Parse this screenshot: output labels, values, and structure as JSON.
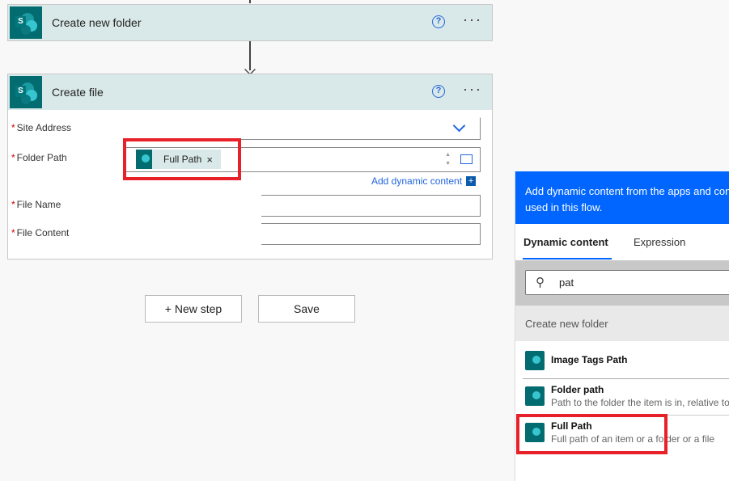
{
  "step1": {
    "title": "Create new folder"
  },
  "step2": {
    "title": "Create file",
    "fields": [
      {
        "label": "Site Address",
        "required": true
      },
      {
        "label": "Folder Path",
        "required": true,
        "token": "Full Path"
      },
      {
        "label": "File Name",
        "required": true
      },
      {
        "label": "File Content",
        "required": true
      }
    ],
    "add_dynamic": "Add dynamic content"
  },
  "actions": {
    "new_step": "+ New step",
    "save": "Save"
  },
  "panel": {
    "banner": "Add dynamic content from the apps and connectors used in this flow.",
    "tabs": [
      {
        "label": "Dynamic content",
        "active": true
      },
      {
        "label": "Expression"
      }
    ],
    "search_value": "pat",
    "section": "Create new folder",
    "items": [
      {
        "title": "Image Tags Path",
        "desc": ""
      },
      {
        "title": "Folder path",
        "desc": "Path to the folder the item is in, relative to"
      },
      {
        "title": "Full Path",
        "desc": "Full path of an item or a folder or a file"
      }
    ]
  },
  "colors": {
    "accent": "#0066ff",
    "highlight": "#e8202a",
    "sharepoint": "#036c70"
  }
}
